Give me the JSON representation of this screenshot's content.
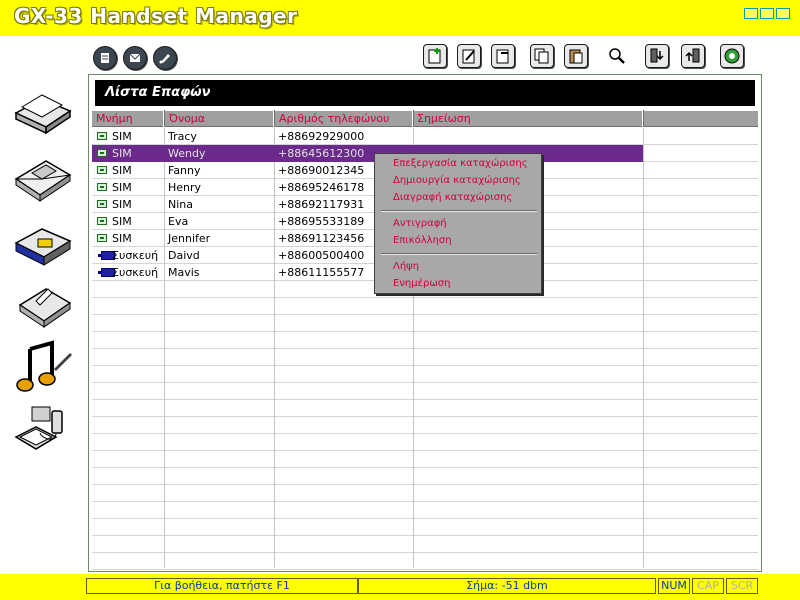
{
  "window": {
    "title": "GX-33 Handset Manager"
  },
  "colors": {
    "app_bg": "#ffff00",
    "selection": "#6b2a8c",
    "header_text": "#d0003a",
    "status_text": "#0040a0"
  },
  "toolbar_left": [
    {
      "name": "phonebook-icon"
    },
    {
      "name": "messages-icon"
    },
    {
      "name": "note-icon"
    }
  ],
  "toolbar_right": [
    {
      "name": "new-entry-icon"
    },
    {
      "name": "edit-entry-icon"
    },
    {
      "name": "delete-entry-icon"
    },
    {
      "name": "copy-icon"
    },
    {
      "name": "paste-icon"
    },
    {
      "name": "search-icon"
    },
    {
      "name": "download-phone-icon"
    },
    {
      "name": "upload-phone-icon"
    },
    {
      "name": "sync-icon"
    }
  ],
  "sidebar": [
    {
      "name": "sidebar-phonebook",
      "icon": "phonebook-book-icon"
    },
    {
      "name": "sidebar-messages",
      "icon": "envelope-icon"
    },
    {
      "name": "sidebar-data",
      "icon": "data-folder-icon"
    },
    {
      "name": "sidebar-memo",
      "icon": "memo-icon"
    },
    {
      "name": "sidebar-ringtones",
      "icon": "music-note-icon"
    },
    {
      "name": "sidebar-connection",
      "icon": "phone-pc-connection-icon"
    }
  ],
  "list": {
    "title": "Λίστα Επαφών",
    "columns": [
      "Μνήμη",
      "Όνομα",
      "Αριθμός τηλεφώνου",
      "Σημείωση"
    ],
    "rows": [
      {
        "memory": "SIM",
        "memory_icon": "sim-card-icon",
        "name": "Tracy",
        "phone": "+88692929000",
        "note": ""
      },
      {
        "memory": "SIM",
        "memory_icon": "sim-card-icon",
        "name": "Wendy",
        "phone": "+88645612300",
        "note": "",
        "selected": true
      },
      {
        "memory": "SIM",
        "memory_icon": "sim-card-icon",
        "name": "Fanny",
        "phone": "+88690012345",
        "note": ""
      },
      {
        "memory": "SIM",
        "memory_icon": "sim-card-icon",
        "name": "Henry",
        "phone": "+88695246178",
        "note": ""
      },
      {
        "memory": "SIM",
        "memory_icon": "sim-card-icon",
        "name": "Nina",
        "phone": "+88692117931",
        "note": ""
      },
      {
        "memory": "SIM",
        "memory_icon": "sim-card-icon",
        "name": "Eva",
        "phone": "+88695533189",
        "note": ""
      },
      {
        "memory": "SIM",
        "memory_icon": "sim-card-icon",
        "name": "Jennifer",
        "phone": "+88691123456",
        "note": ""
      },
      {
        "memory": "Συσκευή",
        "memory_icon": "device-phone-icon",
        "name": "Daivd",
        "phone": "+88600500400",
        "note": ""
      },
      {
        "memory": "Συσκευή",
        "memory_icon": "device-phone-icon",
        "name": "Mavis",
        "phone": "+88611155577",
        "note": ""
      }
    ]
  },
  "context_menu": {
    "items": [
      {
        "label": "Επεξεργασία καταχώρισης",
        "name": "menu-edit-entry"
      },
      {
        "label": "Δημιουργία καταχώρισης",
        "name": "menu-create-entry"
      },
      {
        "label": "Διαγραφή καταχώρισης",
        "name": "menu-delete-entry"
      },
      {
        "label": "Αντιγραφή",
        "name": "menu-copy"
      },
      {
        "label": "Επικόλληση",
        "name": "menu-paste"
      },
      {
        "label": "Λήψη",
        "name": "menu-download"
      },
      {
        "label": "Ενημέρωση",
        "name": "menu-update"
      }
    ]
  },
  "status": {
    "help": "Για βοήθεια, πατήστε F1",
    "signal": "Σήμα: -51 dbm",
    "num": "NUM",
    "cap": "CAP",
    "scr": "SCR"
  }
}
